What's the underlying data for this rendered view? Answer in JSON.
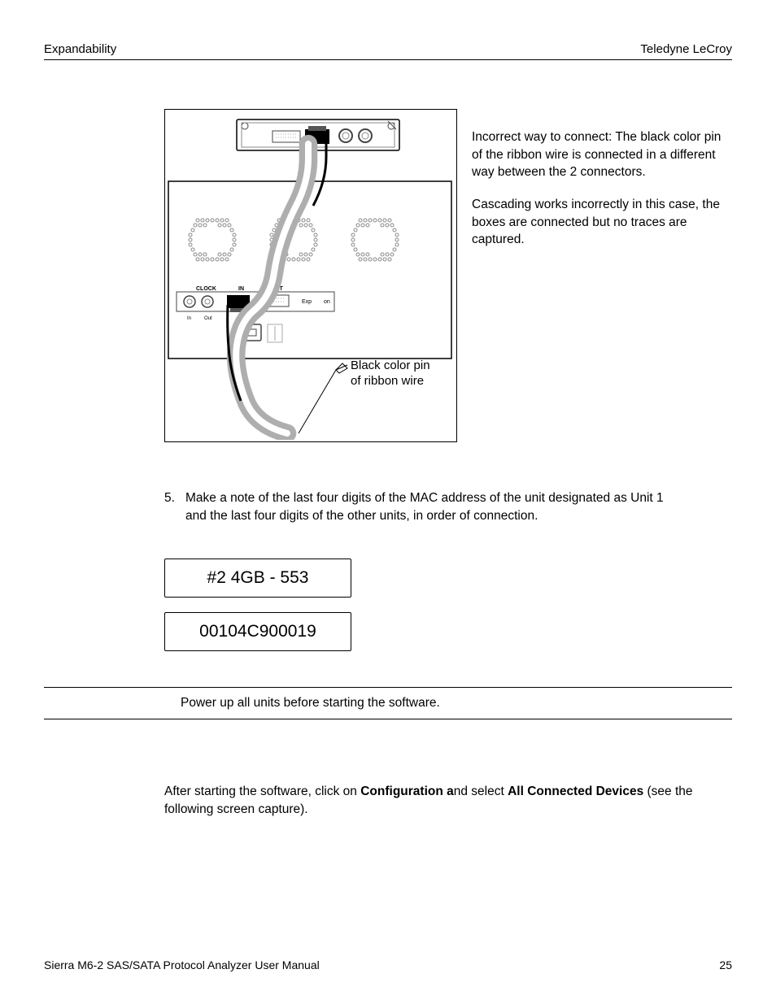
{
  "header": {
    "left": "Expandability",
    "right": "Teledyne LeCroy"
  },
  "diagram": {
    "port_clock": "CLOCK",
    "port_in": "In",
    "port_out": "Out",
    "port_in_upper": "IN",
    "port_out_upper": "OUT",
    "port_exp": "Exp",
    "port_on": "on",
    "callout_line1": "Black color pin",
    "callout_line2": "of ribbon wire"
  },
  "side": {
    "para1": "Incorrect way to connect: The black color pin of the ribbon wire is connected in a different way between the 2 connectors.",
    "para2": "Cascading works incorrectly in this case, the boxes are connected but no traces are captured."
  },
  "step5": {
    "num": "5.",
    "text": "Make a note of the last four digits of the MAC address of the unit designated as Unit 1 and the last four digits of the other units, in order of connection."
  },
  "label1": "#2  4GB - 553",
  "label2": "00104C900019",
  "note": "Power up all units before starting the software.",
  "after": {
    "t1": "After starting the software, click on ",
    "b1": "Configuration a",
    "t2": "nd select ",
    "b2": "All Connected Devices",
    "t3": " (see the following screen capture)."
  },
  "footer": {
    "left": "Sierra M6-2 SAS/SATA Protocol Analyzer User Manual",
    "right": "25"
  }
}
